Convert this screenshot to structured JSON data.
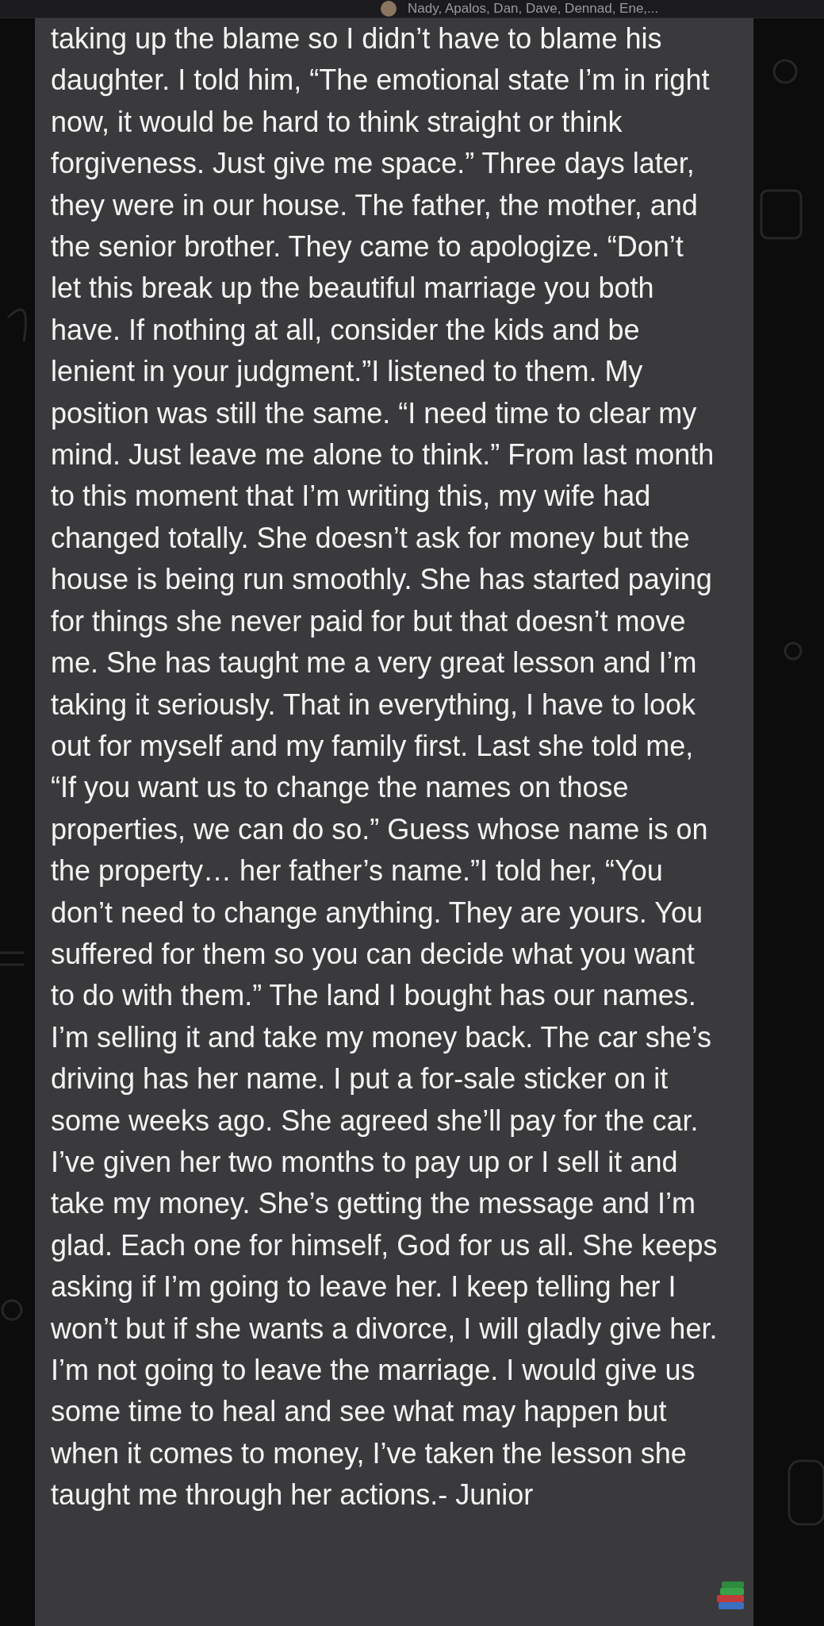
{
  "header": {
    "title": "Nady, Apalos, Dan, Dave, Dennad, Ene,..."
  },
  "message": {
    "text": "taking up the blame so I didn’t have to blame his daughter. I told him, “The emotional state I’m in right now, it would be hard to think straight or think forgiveness. Just give me space.” Three days later, they were in our house. The father, the mother, and the senior brother. They came to apologize. “Don’t let this break up the beautiful marriage you both have. If nothing at all, consider the kids and be lenient in your judgment.”I listened to them. My position was still the same. “I need time to clear my mind. Just leave me alone to think.” From last month to this moment that I’m writing this, my wife had changed totally. She doesn’t ask for money but the house is being run smoothly. She has started paying for things she never paid for but that doesn’t move me. She has taught me a very great lesson and I’m taking it seriously. That in everything, I have to look out for myself and my family first. Last she told me, “If you want us to change the names on those properties, we can do so.” Guess whose name is on the property… her father’s name.”I told her, “You don’t need to change anything. They are yours. You suffered for them so you can decide what you want to do with them.” The land I bought has our names. I’m selling it and take my money back. The car she’s driving has her name. I put a for-sale sticker on it some weeks ago. She agreed she’ll pay for the car. I’ve given her two months to pay up or I sell it and take my money. She’s getting the message and I’m glad. Each one for himself, God for us all. She keeps asking if I’m going to leave her. I keep telling her I won’t but if she wants a divorce, I will gladly give her. I’m not going to leave the marriage. I would give us some time to heal and see what may happen but when it comes to money, I’ve taken the lesson she taught me through her actions.- Junior"
  }
}
